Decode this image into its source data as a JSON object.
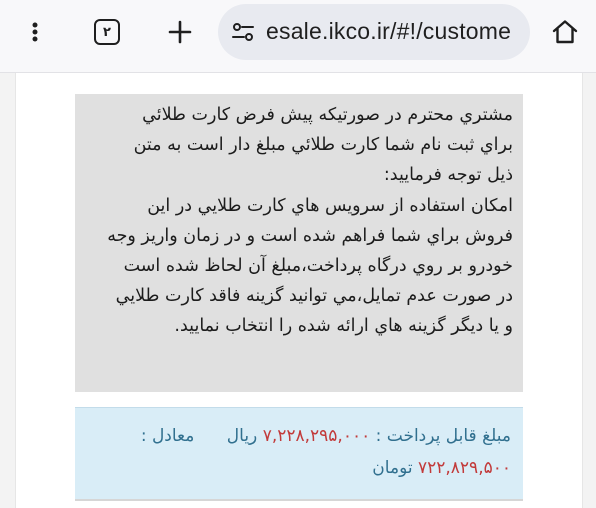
{
  "browser": {
    "tab_count": "۲",
    "url": "esale.ikco.ir/#!/custome",
    "icons": {
      "menu": "three-dots-vertical-icon",
      "tabs": "tab-switcher-icon",
      "new_tab": "plus-icon",
      "site_info": "tune-icon",
      "home": "home-icon"
    }
  },
  "notice": {
    "lines": [
      "مشتري محترم در صورتيكه پيش فرض كارت طلائي",
      "براي ثبت نام شما كارت طلائي مبلغ دار است به متن",
      "ذيل توجه فرماييد:",
      "امكان استفاده از سرويس هاي كارت طلايي در اين",
      "فروش براي شما فراهم شده است و در زمان واريز وجه",
      "خودرو بر روي درگاه پرداخت،مبلغ آن لحاظ شده است",
      "در صورت عدم تمايل،مي توانيد گزينه فاقد كارت طلايي",
      "و يا ديگر گزينه هاي ارائه شده را انتخاب نماييد."
    ]
  },
  "payment": {
    "label": "مبلغ قابل پرداخت :",
    "amount_rial": "۷,۲۲۸,۲۹۵,۰۰۰",
    "rial_unit": "ريال",
    "equivalent_label": "معادل :",
    "amount_toman": "۷۲۲,۸۲۹,۵۰۰",
    "toman_unit": "تومان"
  },
  "colors": {
    "notice_bg": "#e0e0e0",
    "payment_bg": "#d9edf7",
    "payment_text": "#31708f",
    "amount_text": "#c23a3a"
  }
}
